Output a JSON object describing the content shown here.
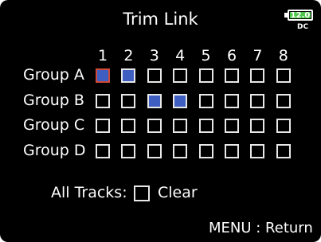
{
  "title": "Trim Link",
  "status": {
    "battery_voltage": "12.0",
    "power_source": "DC",
    "battery_color": "#4ec44a"
  },
  "columns": [
    "1",
    "2",
    "3",
    "4",
    "5",
    "6",
    "7",
    "8"
  ],
  "groups": [
    {
      "label": "Group A",
      "tracks_linked": [
        1,
        2
      ]
    },
    {
      "label": "Group B",
      "tracks_linked": [
        3,
        4
      ]
    },
    {
      "label": "Group C",
      "tracks_linked": []
    },
    {
      "label": "Group D",
      "tracks_linked": []
    }
  ],
  "cursor": {
    "group": "Group A",
    "track": 1
  },
  "all_tracks": {
    "label": "All Tracks:",
    "checked": false,
    "action_label": "Clear"
  },
  "footer": {
    "hint": "MENU : Return"
  },
  "colors": {
    "linked": "#3f5ec2",
    "cursor": "#d04a38",
    "background": "#000000"
  }
}
